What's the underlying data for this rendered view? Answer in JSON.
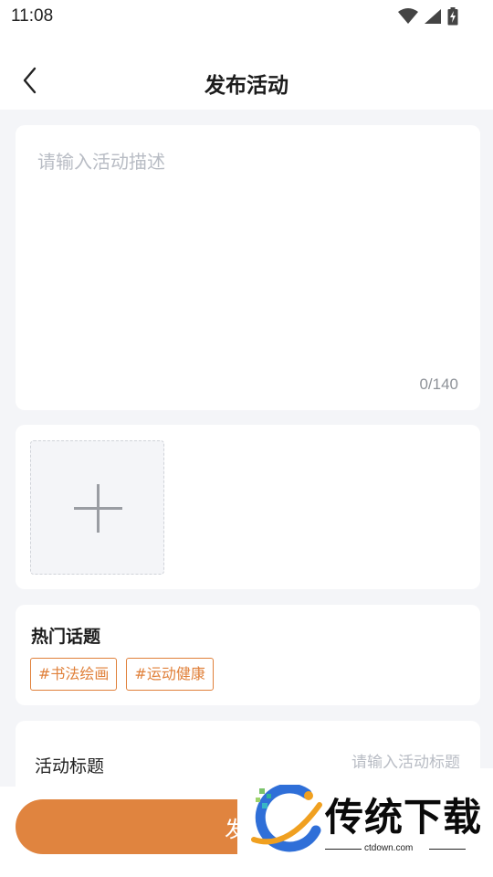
{
  "status_bar": {
    "time": "11:08",
    "icons": [
      "wifi-icon",
      "signal-icon",
      "battery-charging-icon"
    ]
  },
  "nav": {
    "title": "发布活动",
    "back_icon": "chevron-left-icon"
  },
  "description": {
    "placeholder": "请输入活动描述",
    "counter": "0/140"
  },
  "image_upload": {
    "add_icon": "plus-icon"
  },
  "topics": {
    "title": "热门话题",
    "tags": [
      "#书法绘画",
      "#运动健康"
    ]
  },
  "activity_title": {
    "label": "活动标题",
    "placeholder": "请输入活动标题",
    "value": ""
  },
  "submit": {
    "label": "发布"
  },
  "watermark": {
    "text": "传统下载",
    "url": "ctdown.com"
  },
  "colors": {
    "accent": "#e0843f",
    "background": "#f4f5f8",
    "placeholder": "#b8bcc4"
  }
}
